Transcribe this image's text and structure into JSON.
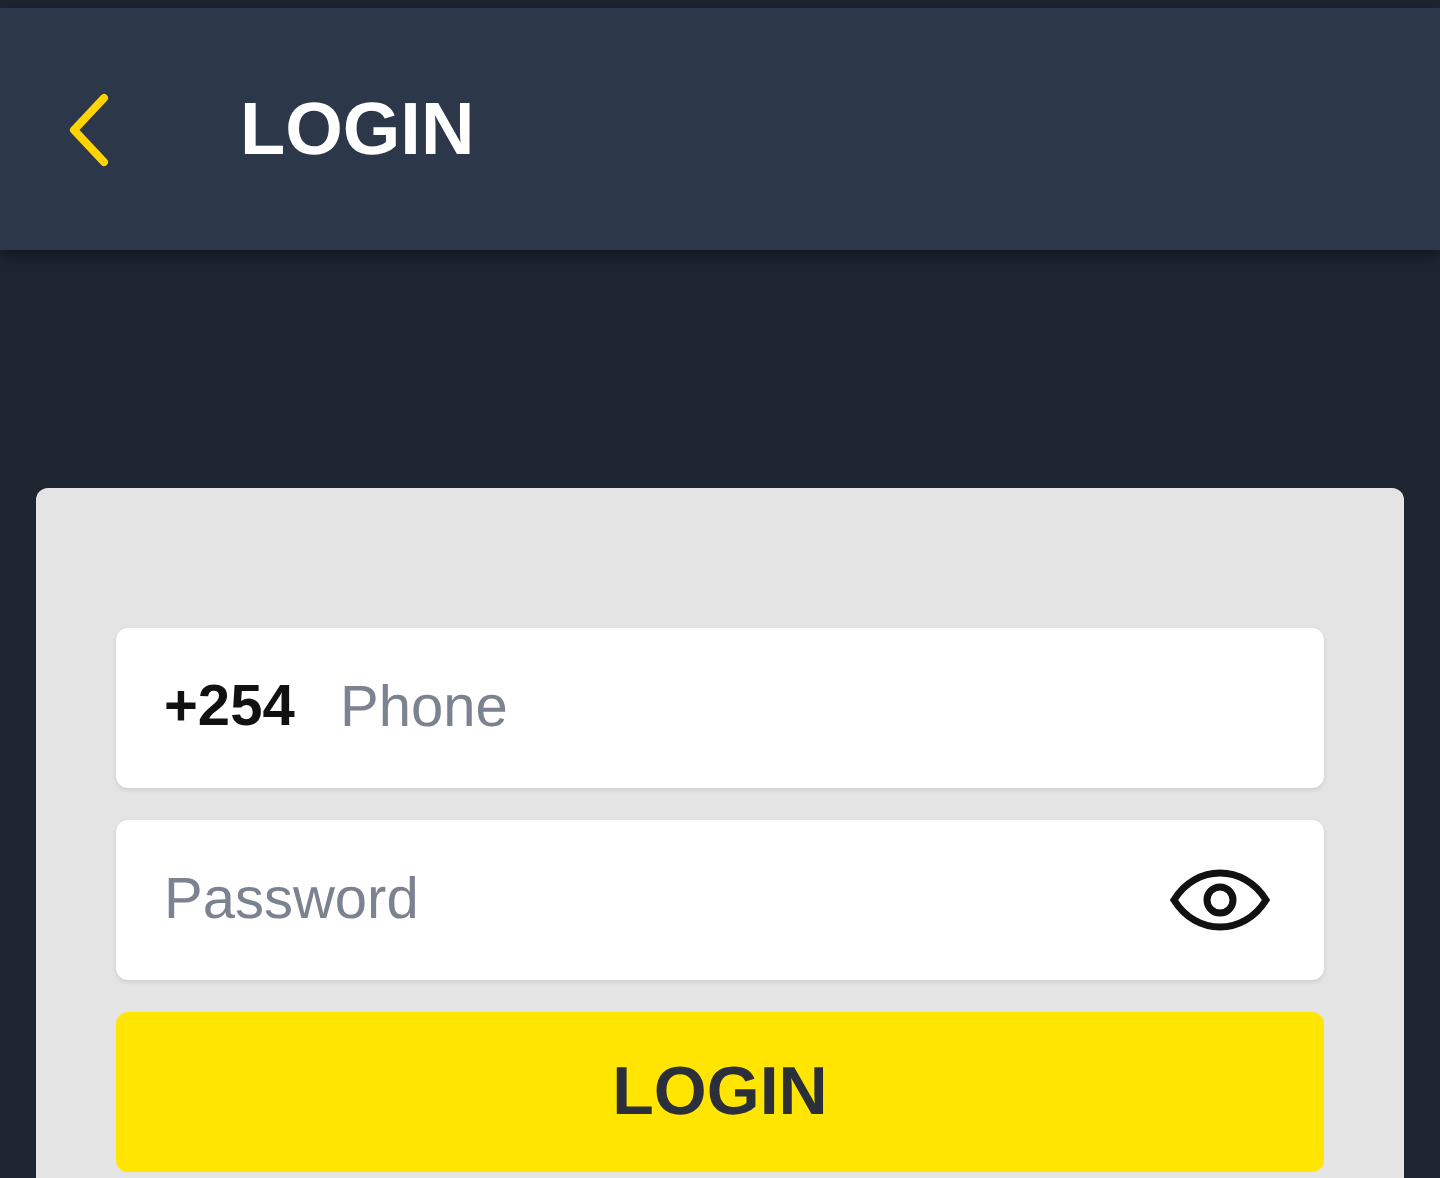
{
  "header": {
    "title": "LOGIN"
  },
  "form": {
    "phone": {
      "prefix": "+254",
      "placeholder": "Phone"
    },
    "password": {
      "placeholder": "Password"
    },
    "submit": "LOGIN"
  }
}
